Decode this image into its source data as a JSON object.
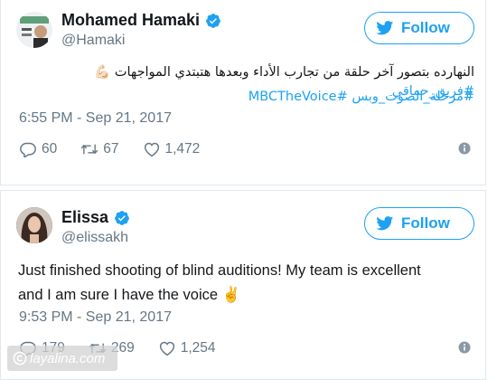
{
  "colors": {
    "accent": "#1da1f2",
    "text": "#14171a",
    "muted": "#657786",
    "border": "#e1e8ed",
    "heart_emoji": "#f6a3a5"
  },
  "tweets": [
    {
      "display_name": "Mohamed Hamaki",
      "handle": "@Hamaki",
      "follow_label": "Follow",
      "text_line1": "النهارده بتصور آخر حلقة من تجارب الأداء وبعدها هتبتدي المواجهات",
      "text_line1_emoji": "💪🏻",
      "text_line1_hashtag": "#فريق_حماقي",
      "text_line2": "#مرحلة_الصوت_وبس #MBCTheVoice",
      "timestamp": "6:55 PM - Sep 21, 2017",
      "replies": "60",
      "retweets": "67",
      "likes": "1,472"
    },
    {
      "display_name": "Elissa",
      "handle": "@elissakh",
      "follow_label": "Follow",
      "text_line1": "Just finished shooting of blind auditions! My team is excellent",
      "text_line2": "and I am sure I have the voice",
      "text_emoji": "✌️",
      "timestamp": "9:53 PM - Sep 21, 2017",
      "replies": "179",
      "retweets": "269",
      "likes": "1,254"
    }
  ],
  "watermark": {
    "text": "layalina.com",
    "icon": "copyright-icon"
  }
}
